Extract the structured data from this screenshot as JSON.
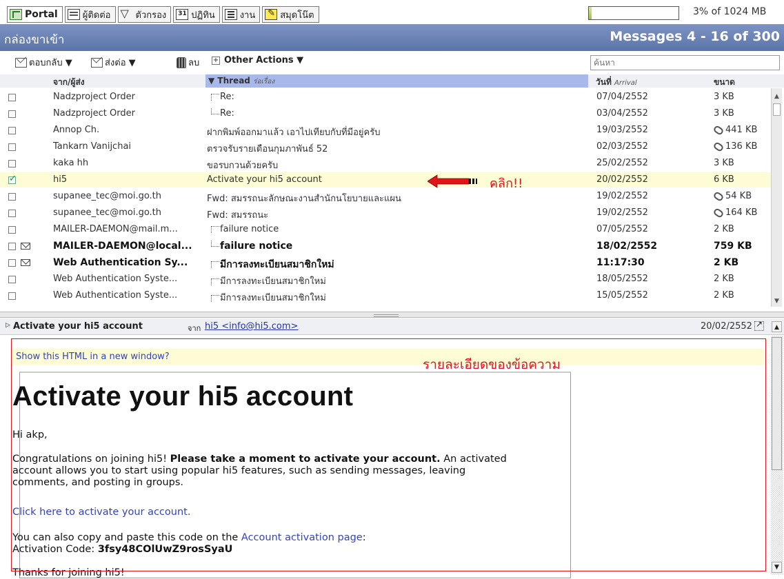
{
  "tabs": [
    {
      "label": "Portal",
      "icon": "portal-icon"
    },
    {
      "label": "ผู้ติดต่อ",
      "icon": "contacts-icon"
    },
    {
      "label": "ตัวกรอง",
      "icon": "filter-icon"
    },
    {
      "label": "ปฏิทิน",
      "icon": "calendar-icon"
    },
    {
      "label": "งาน",
      "icon": "tasks-icon"
    },
    {
      "label": "สมุดโน๊ต",
      "icon": "notes-icon"
    }
  ],
  "quota": {
    "text": "3% of 1024 MB",
    "used_fraction": 0.03
  },
  "header": {
    "folder": "กล่องขาเข้า",
    "range": "Messages 4 - 16 of 300"
  },
  "toolbar": {
    "reply": "ตอบกลับ ▼",
    "forward": "ส่งต่อ ▼",
    "delete": "ลบ",
    "other": "Other Actions ▼",
    "plus": "+"
  },
  "search": {
    "placeholder": "ค้นหา"
  },
  "columns": {
    "from": "จาก/ผู้ส่ง",
    "thread": "▼ Thread",
    "thread_sub": "ร่อเรื่อง",
    "date": "วันที่",
    "date_sub": "Arrival",
    "size": "ขนาด"
  },
  "messages": [
    {
      "from": "Nadzproject Order",
      "subject": "Re:",
      "date": "07/04/2552",
      "size": "3 KB"
    },
    {
      "from": "Nadzproject Order",
      "subject": "Re:",
      "date": "03/04/2552",
      "size": "3 KB"
    },
    {
      "from": "Annop Ch.",
      "subject": "ฝากพิมพ์ออกมาแล้ว เอาไปเทียบกับที่มีอยู่ครับ",
      "date": "19/03/2552",
      "size": "441 KB"
    },
    {
      "from": "Tankarn Vanijchai",
      "subject": "ตรวจรับรายเดือนกุมภาพันธ์ 52",
      "date": "02/03/2552",
      "size": "136 KB"
    },
    {
      "from": "kaka hh",
      "subject": "ขอรบกวนด้วยครับ",
      "date": "25/02/2552",
      "size": "3 KB"
    },
    {
      "from": "hi5",
      "subject": "Activate your hi5 account",
      "date": "20/02/2552",
      "size": "6 KB"
    },
    {
      "from": "supanee_tec@moi.go.th",
      "subject": "Fwd: สมรรถนะลักษณะงานสำนักนโยบายและแผน",
      "date": "19/02/2552",
      "size": "54 KB"
    },
    {
      "from": "supanee_tec@moi.go.th",
      "subject": "Fwd: สมรรถนะ",
      "date": "19/02/2552",
      "size": "164 KB"
    },
    {
      "from": "MAILER-DAEMON@mail.m...",
      "subject": "failure notice",
      "date": "07/05/2552",
      "size": "2 KB"
    },
    {
      "from": "MAILER-DAEMON@local...",
      "subject": "failure notice",
      "date": "18/02/2552",
      "size": "759 KB"
    },
    {
      "from": "Web Authentication Sy...",
      "subject": "มีการลงทะเบียนสมาชิกใหม่",
      "date": "11:17:30",
      "size": "2 KB"
    },
    {
      "from": "Web Authentication Syste...",
      "subject": "มีการลงทะเบียนสมาชิกใหม่",
      "date": "18/05/2552",
      "size": "2 KB"
    },
    {
      "from": "Web Authentication Syste...",
      "subject": "มีการลงทะเบียนสมาชิกใหม่",
      "date": "15/05/2552",
      "size": "2 KB"
    }
  ],
  "annotations": {
    "click": "คลิก!!",
    "detail": "รายละเอียดของข้อความ"
  },
  "preview": {
    "subject": "Activate your hi5 account",
    "from_label": "จาก",
    "from_addr": "hi5 <info@hi5.com>",
    "date": "20/02/2552",
    "show_html": "Show this HTML in a new window?",
    "title": "Activate your hi5 account",
    "greeting": "Hi akp,",
    "congrats_a": "Congratulations on joining hi5! ",
    "congrats_b": "Please take a moment to activate your account.",
    "congrats_c": " An activated",
    "congrats_line2": "account allows you to start using popular hi5 features, such as sending messages, leaving",
    "congrats_line3": "comments, and posting in groups.",
    "activate_link": "Click here to activate your account.",
    "copy_text": "You can also copy and paste this code on the ",
    "copy_link": "Account activation page",
    "copy_colon": ":",
    "code_label": "Activation Code: ",
    "code": "3fsy48COlUwZ9rosSyaU",
    "thanks": "Thanks for joining hi5!"
  },
  "colors": {
    "title_bar": "#6a82b6",
    "selected_row": "#fefcd4",
    "annotation": "#e0141b",
    "link": "#3344bb"
  }
}
